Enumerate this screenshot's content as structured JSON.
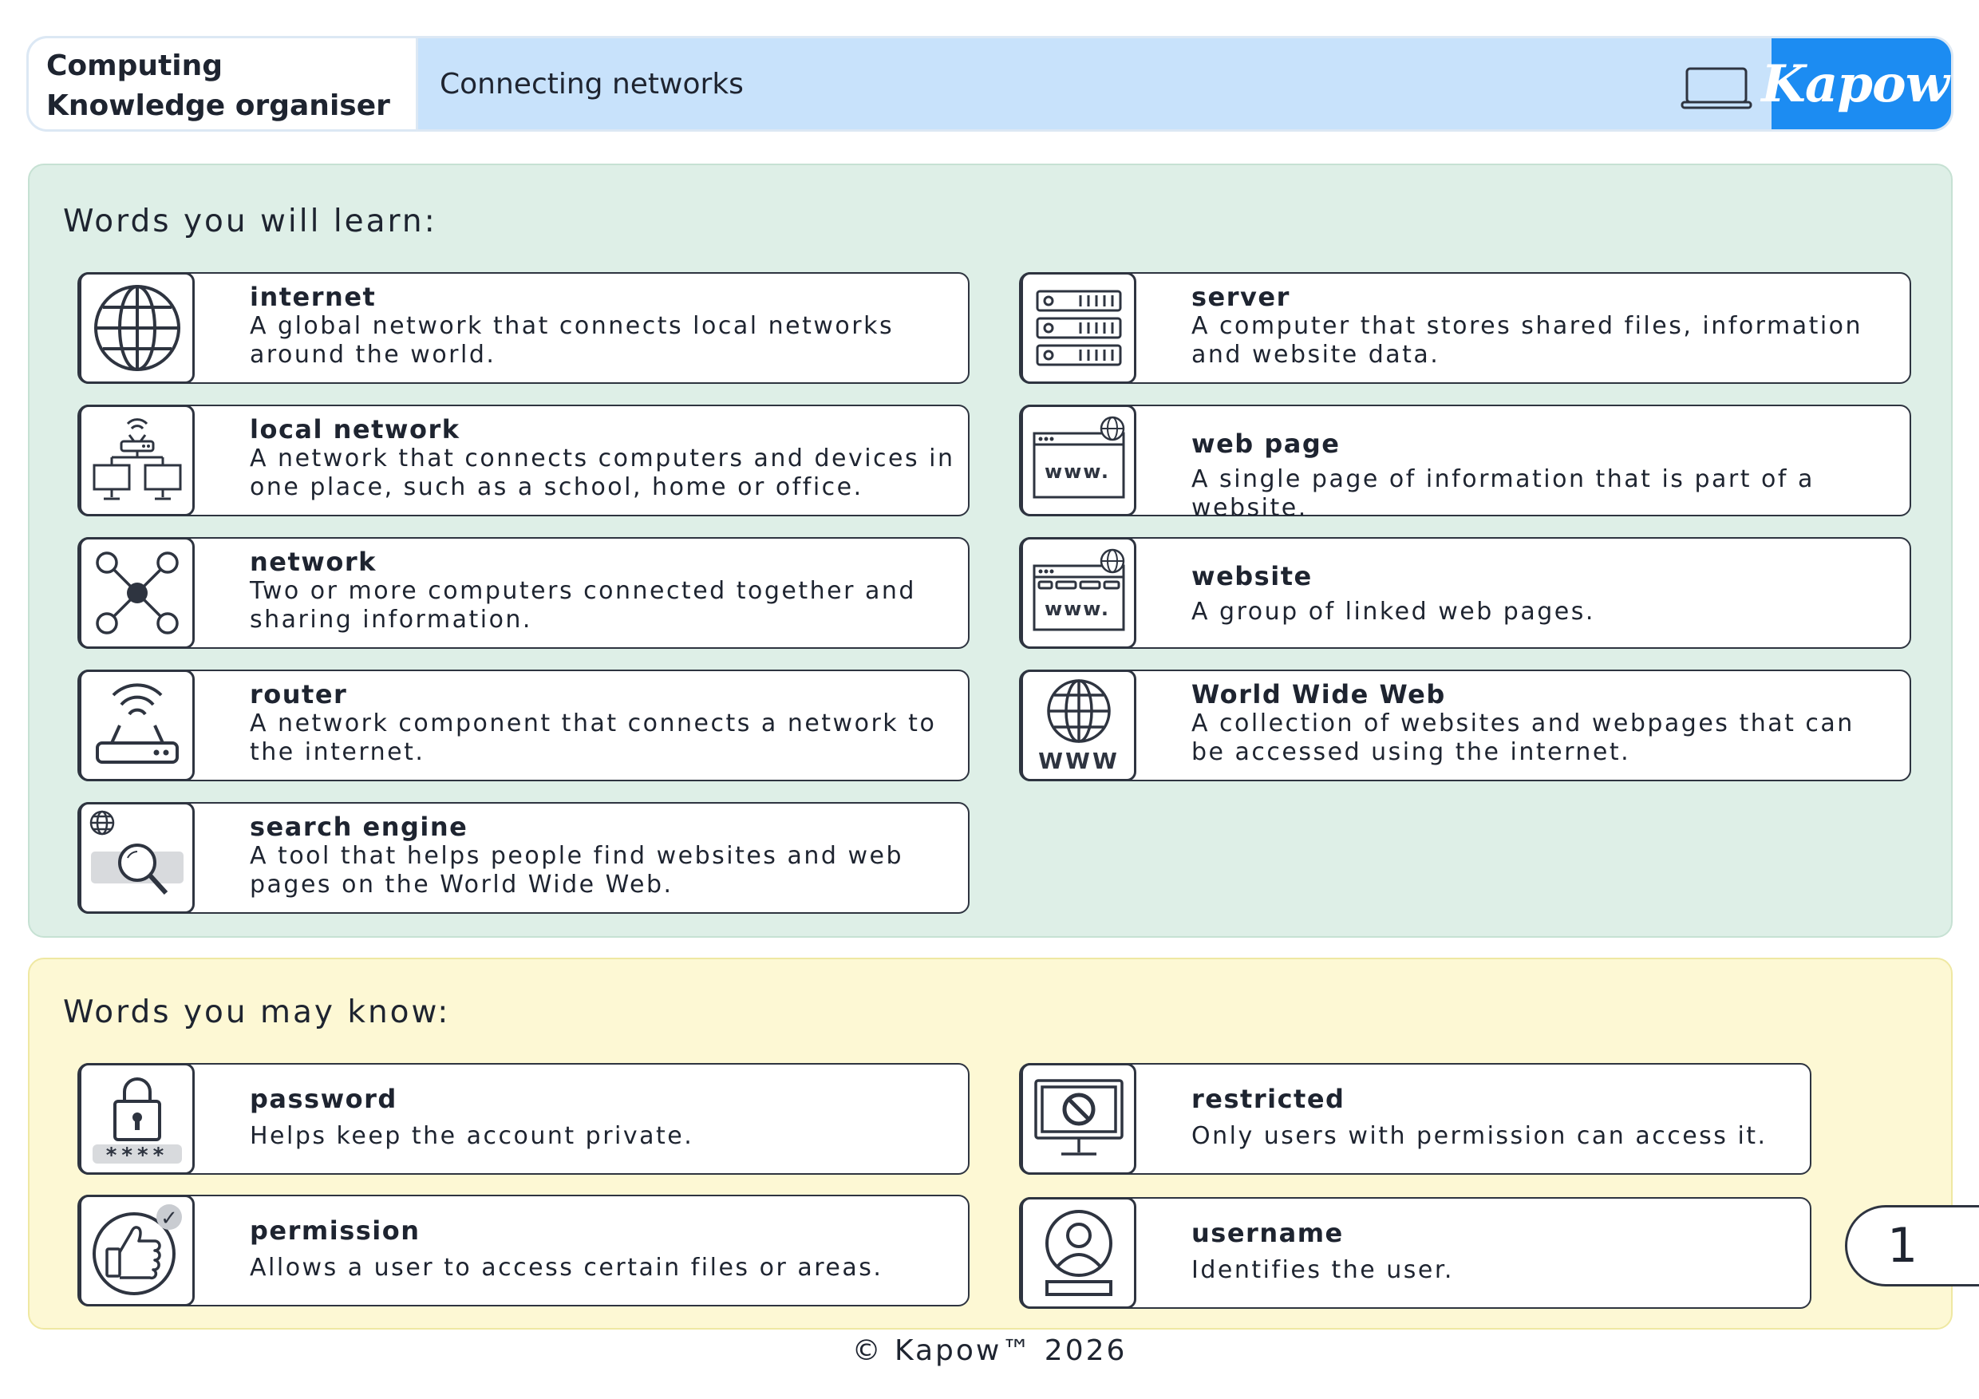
{
  "header": {
    "subject_line1": "Computing",
    "subject_line2": "Knowledge organiser",
    "topic": "Connecting networks",
    "brand": "Kapow",
    "brand_mark": "™",
    "topic_icon": "laptop-icon"
  },
  "words_learn": {
    "title": "Words you will learn:",
    "items": [
      {
        "term": "internet",
        "definition": "A global network that connects local networks around the world.",
        "icon": "globe-icon"
      },
      {
        "term": "local network",
        "definition": "A network that connects computers and devices in one place, such as a school, home or office.",
        "icon": "local-network-icon"
      },
      {
        "term": "network",
        "definition": "Two or more computers connected together and sharing information.",
        "icon": "network-icon"
      },
      {
        "term": "router",
        "definition": "A network component that connects a network to the internet.",
        "icon": "router-icon"
      },
      {
        "term": "search engine",
        "definition": "A tool that helps people find websites and web pages on the World Wide Web.",
        "icon": "search-engine-icon"
      },
      {
        "term": "server",
        "definition": "A computer that stores shared files, information and website data.",
        "icon": "server-icon"
      },
      {
        "term": "web page",
        "definition": "A single page of information that is part of a website.",
        "icon": "web-page-icon",
        "icon_text": "www."
      },
      {
        "term": "website",
        "definition": "A group of linked web pages.",
        "icon": "website-icon",
        "icon_text": "www."
      },
      {
        "term": "World Wide Web",
        "definition": "A collection of websites and webpages that can be accessed using the internet.",
        "icon": "www-globe-icon",
        "icon_text": "WWW"
      }
    ]
  },
  "words_know": {
    "title": "Words you may know:",
    "items": [
      {
        "term": "password",
        "definition": "Helps keep the account private.",
        "icon": "padlock-icon",
        "icon_text": "****"
      },
      {
        "term": "permission",
        "definition": "Allows a user to access certain files or areas.",
        "icon": "thumbs-up-icon",
        "icon_text": "✓"
      },
      {
        "term": "restricted",
        "definition": "Only users with permission can access it.",
        "icon": "restricted-icon"
      },
      {
        "term": "username",
        "definition": "Identifies the user.",
        "icon": "user-icon"
      }
    ]
  },
  "page_number": "1",
  "footer": "© Kapow™ 2026",
  "colors": {
    "header_blue": "#c8e2fb",
    "brand_blue": "#1c8cf2",
    "green_panel": "#deefe7",
    "yellow_panel": "#fdf8d4",
    "ink": "#2e3440"
  }
}
